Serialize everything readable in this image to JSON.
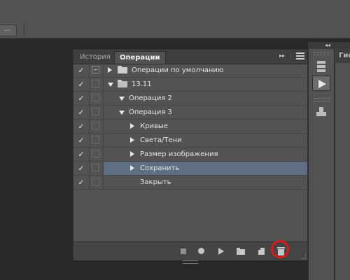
{
  "panel": {
    "tabs": [
      {
        "label": "История",
        "active": false
      },
      {
        "label": "Операции",
        "active": true
      }
    ],
    "rows": [
      {
        "checked": true,
        "dialog": "on",
        "indent": 0,
        "expand": "right",
        "folder": true,
        "label": "Операции по умолчанию",
        "selected": false
      },
      {
        "checked": true,
        "dialog": "off",
        "indent": 0,
        "expand": "down",
        "folder": true,
        "label": "13.11",
        "selected": false
      },
      {
        "checked": true,
        "dialog": "off",
        "indent": 1,
        "expand": "down",
        "folder": false,
        "label": "Операция 2",
        "selected": false
      },
      {
        "checked": true,
        "dialog": "off",
        "indent": 1,
        "expand": "down",
        "folder": false,
        "label": "Операция 3",
        "selected": false
      },
      {
        "checked": true,
        "dialog": "off",
        "indent": 2,
        "expand": "right",
        "folder": false,
        "label": "Кривые",
        "selected": false
      },
      {
        "checked": true,
        "dialog": "off",
        "indent": 2,
        "expand": "right",
        "folder": false,
        "label": "Света/Тени",
        "selected": false
      },
      {
        "checked": true,
        "dialog": "off",
        "indent": 2,
        "expand": "right",
        "folder": false,
        "label": "Размер изображения",
        "selected": false
      },
      {
        "checked": true,
        "dialog": "off",
        "indent": 2,
        "expand": "right",
        "folder": false,
        "label": "Сохранить",
        "selected": true
      },
      {
        "checked": true,
        "dialog": "off",
        "indent": 2,
        "expand": "none",
        "folder": false,
        "label": "Закрыть",
        "selected": false
      }
    ],
    "toolbar": [
      "stop-icon",
      "record-icon",
      "play-icon",
      "new-set-icon",
      "new-action-icon",
      "trash-icon"
    ],
    "highlighted": "trash-icon"
  },
  "topbar": {
    "dots_label": "..."
  },
  "dock": {
    "next_tab_label": "Гис"
  },
  "colors": {
    "selection": "#5e6f84",
    "highlight": "#e01818",
    "panel": "#535353"
  }
}
